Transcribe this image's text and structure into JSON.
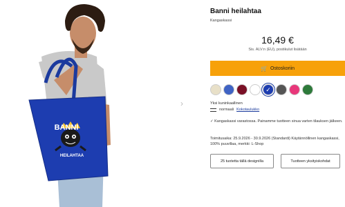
{
  "product": {
    "title": "Banni heilahtaa",
    "subtitle": "Kangaskassi",
    "price": "16,49 €",
    "price_note": "Sis. ALV:n (EU), postikulut lisätään",
    "bag_print_top": "BANNI",
    "bag_print_bottom": "HEILAHTAA"
  },
  "cart": {
    "label": "Ostoskoriin",
    "icon": "cart-icon"
  },
  "colors": [
    {
      "name": "natural",
      "hex": "#e8e0c8",
      "selected": false
    },
    {
      "name": "royal-blue-light",
      "hex": "#3f63c4",
      "selected": false
    },
    {
      "name": "burgundy",
      "hex": "#7a1026",
      "selected": false
    },
    {
      "name": "white",
      "hex": "#ffffff",
      "selected": false
    },
    {
      "name": "royal-blue",
      "hex": "#1d3db0",
      "selected": true
    },
    {
      "name": "graphite",
      "hex": "#555555",
      "selected": false
    },
    {
      "name": "pink",
      "hex": "#e8377a",
      "selected": false
    },
    {
      "name": "green",
      "hex": "#2d7a3a",
      "selected": false
    }
  ],
  "size": {
    "label": "Yksi kuninkaallinen",
    "value": "normaali",
    "link": "Kokotaulukko"
  },
  "feature_text": "Kangaskassi varastossa. Painamme tuotteen sinua varten tilauksen jälkeen.",
  "delivery_text": "Toimitusaika: 25.9.2026 - 30.9.2026 (Standardi) Käytännöllinen kangaskassi, 100% puuvillaa, merkki: L-Shop",
  "buttons": {
    "design": "25 tuotetta tällä designilla",
    "product": "Tuotteen yksityiskohdat"
  }
}
